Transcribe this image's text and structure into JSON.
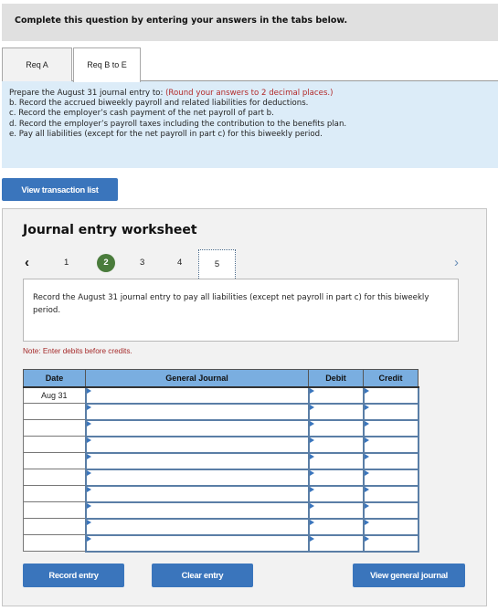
{
  "banner": "Complete this question by entering your answers in the tabs below.",
  "tabs": [
    {
      "label": "Req A",
      "active": false
    },
    {
      "label": "Req B to E",
      "active": true
    }
  ],
  "instructions": {
    "intro": "Prepare the August 31 journal entry to:",
    "rounding_note": "(Round your answers to 2 decimal places.)",
    "items": [
      "b. Record the accrued biweekly payroll and related liabilities for deductions.",
      "c. Record the employer’s cash payment of the net payroll of part b.",
      "d. Record the employer’s payroll taxes including the contribution to the benefits plan.",
      "e. Pay all liabilities (except for the net payroll in part c) for this biweekly period."
    ]
  },
  "view_transaction_list_label": "View transaction list",
  "worksheet": {
    "title": "Journal entry worksheet",
    "pager": {
      "prev_icon": "‹",
      "next_icon": "›",
      "pages": [
        "1",
        "2",
        "3",
        "4",
        "5"
      ],
      "completed_page": "2",
      "current_page": "5"
    },
    "description": "Record the August 31 journal entry to pay all liabilities (except net payroll in part c) for this biweekly period.",
    "note": "Note: Enter debits before credits.",
    "table": {
      "headers": [
        "Date",
        "General Journal",
        "Debit",
        "Credit"
      ],
      "rows": [
        {
          "date": "Aug 31",
          "account": "",
          "debit": "",
          "credit": ""
        },
        {
          "date": "",
          "account": "",
          "debit": "",
          "credit": ""
        },
        {
          "date": "",
          "account": "",
          "debit": "",
          "credit": ""
        },
        {
          "date": "",
          "account": "",
          "debit": "",
          "credit": ""
        },
        {
          "date": "",
          "account": "",
          "debit": "",
          "credit": ""
        },
        {
          "date": "",
          "account": "",
          "debit": "",
          "credit": ""
        },
        {
          "date": "",
          "account": "",
          "debit": "",
          "credit": ""
        },
        {
          "date": "",
          "account": "",
          "debit": "",
          "credit": ""
        },
        {
          "date": "",
          "account": "",
          "debit": "",
          "credit": ""
        },
        {
          "date": "",
          "account": "",
          "debit": "",
          "credit": ""
        }
      ]
    },
    "buttons": {
      "record": "Record entry",
      "clear": "Clear entry",
      "view_general_journal": "View general journal"
    }
  }
}
